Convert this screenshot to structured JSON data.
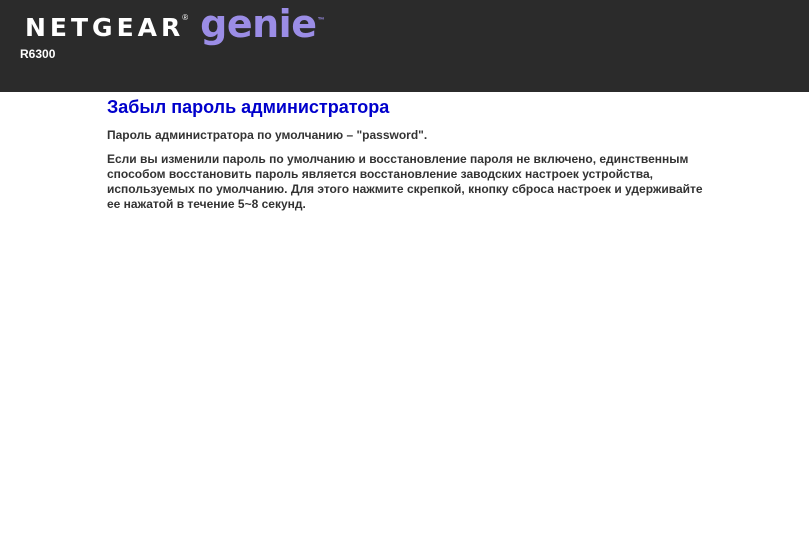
{
  "header": {
    "brand": "NETGEAR",
    "brand_reg": "®",
    "product": "genie",
    "product_tm": "™",
    "model": "R6300"
  },
  "main": {
    "title": "Забыл пароль администратора",
    "default_password_text": "Пароль администратора по умолчанию – \"password\".",
    "reset_instructions": "Если вы изменили пароль по умолчанию и восстановление пароля не включено, единственным способом восстановить пароль является восстановление заводских настроек устройства, используемых по умолчанию. Для этого нажмите скрепкой, кнопку сброса настроек и удерживайте ее нажатой в течение 5~8 секунд."
  },
  "colors": {
    "header_bg": "#2b2b2b",
    "genie_purple": "#9b8de6",
    "title_blue": "#0000cc",
    "body_text": "#333333"
  }
}
